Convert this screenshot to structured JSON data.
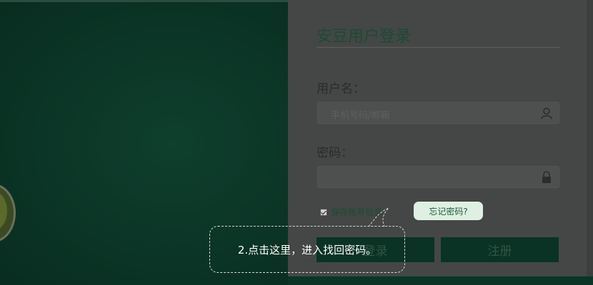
{
  "login": {
    "title": "安豆用户登录",
    "username_label": "用户名：",
    "username_placeholder": "手机号码/邮箱",
    "password_label": "密码：",
    "password_placeholder": "",
    "remember_label": "保存账号信息",
    "forgot_label": "忘记密码?",
    "login_button": "登录",
    "register_button": "注册"
  },
  "guide": {
    "tooltip_text": "2.点击这里，进入找回密码。"
  },
  "icons": {
    "username": "user-icon",
    "password": "lock-icon"
  },
  "colors": {
    "background": "#0b3526",
    "panel": "#444746",
    "button": "#0a3325",
    "forgot_button": "#dff0e3"
  }
}
